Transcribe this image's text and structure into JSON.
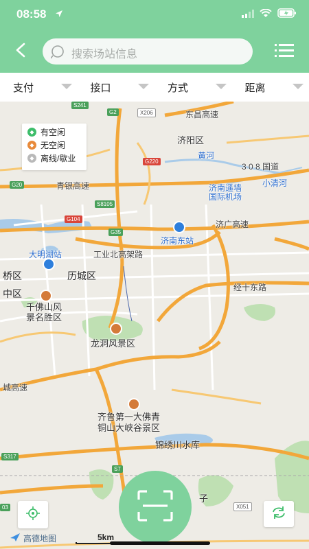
{
  "status_bar": {
    "time": "08:58"
  },
  "header": {
    "search_placeholder": "搜索场站信息"
  },
  "filters": [
    {
      "label": "支付"
    },
    {
      "label": "接口"
    },
    {
      "label": "方式"
    },
    {
      "label": "距离"
    }
  ],
  "legend": [
    {
      "label": "有空闲",
      "color": "#3dbd6a"
    },
    {
      "label": "无空闲",
      "color": "#e88a3a"
    },
    {
      "label": "离线/歇业",
      "color": "#b9b9b9"
    }
  ],
  "map": {
    "labels": {
      "jiyang": "济阳区",
      "qingyin": "青银高速",
      "dongqu": "东昌高速",
      "guodao308": "3 0 8 国道",
      "xiaoqinghe": "小清河",
      "airport": "济南遥墙\n国际机场",
      "jiguang": "济广高速",
      "jinan_east": "济南东站",
      "daminghu": "大明湖站",
      "gongyebei": "工业北高架路",
      "licheng": "历城区",
      "qiaoqu": "桥区",
      "zhongqu": "中区",
      "qianfoshan": "千佛山风\n景名胜区",
      "jingshi": "经十东路",
      "longdong": "龙洞风景区",
      "raocheng": "城高速",
      "dafo": "齐鲁第一大佛青\n铜山大峡谷景区",
      "jinxiu": "锦绣川水库",
      "huangshan": "黄河",
      "jingshan": "子"
    },
    "shields": {
      "s241": "S241",
      "g2": "G2",
      "x206": "X206",
      "g220": "G220",
      "g20": "G20",
      "s8105": "S8105",
      "g104": "G104",
      "g35": "G35",
      "s317": "S317",
      "s7": "S7",
      "x051": "X051",
      "s3": "03"
    },
    "attribution": "高德地图",
    "scale": "5km"
  },
  "icons": {
    "back": "back-arrow-icon",
    "search": "search-icon",
    "menu": "list-menu-icon",
    "locate": "locate-icon",
    "scan": "scan-icon",
    "refresh": "refresh-icon"
  }
}
